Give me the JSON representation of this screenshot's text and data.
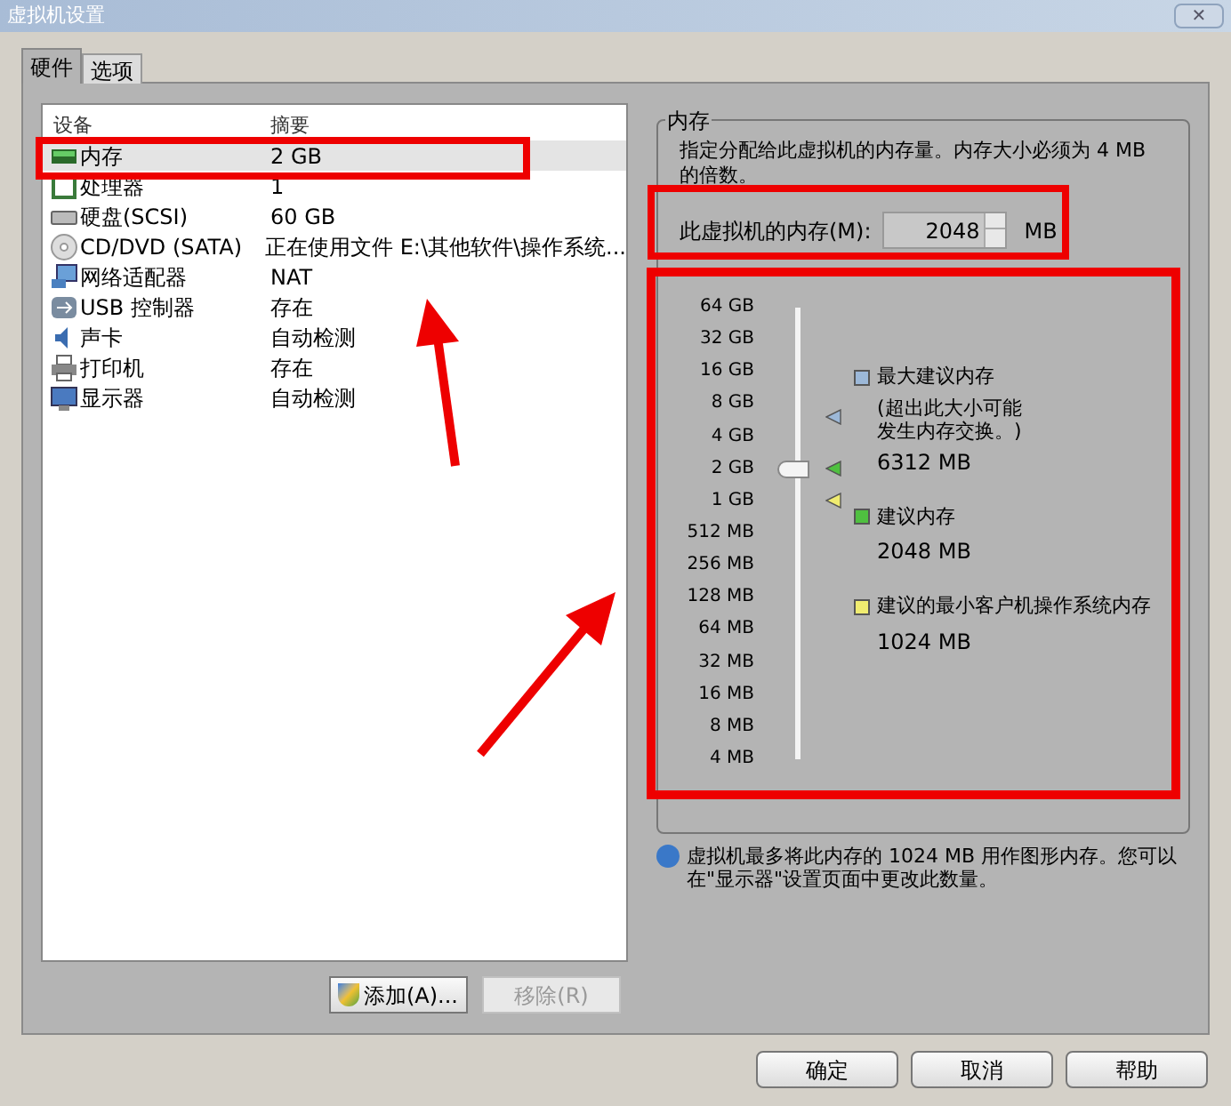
{
  "window": {
    "title": "虚拟机设置",
    "close": "✕"
  },
  "tabs": [
    {
      "label": "硬件",
      "selected": true
    },
    {
      "label": "选项",
      "selected": false
    }
  ],
  "devices": {
    "columns": [
      "设备",
      "摘要"
    ],
    "rows": [
      {
        "name": "内存",
        "summary": "2 GB",
        "selected": true
      },
      {
        "name": "处理器",
        "summary": "1",
        "selected": false
      },
      {
        "name": "硬盘(SCSI)",
        "summary": "60 GB",
        "selected": false
      },
      {
        "name": "CD/DVD (SATA)",
        "summary": "正在使用文件 E:\\其他软件\\操作系统...",
        "selected": false
      },
      {
        "name": "网络适配器",
        "summary": "NAT",
        "selected": false
      },
      {
        "name": "USB 控制器",
        "summary": "存在",
        "selected": false
      },
      {
        "name": "声卡",
        "summary": "自动检测",
        "selected": false
      },
      {
        "name": "打印机",
        "summary": "存在",
        "selected": false
      },
      {
        "name": "显示器",
        "summary": "自动检测",
        "selected": false
      }
    ]
  },
  "list_buttons": [
    {
      "label": "添加(A)...",
      "disabled": false
    },
    {
      "label": "移除(R)",
      "disabled": true
    }
  ],
  "memory": {
    "title": "内存",
    "description": "指定分配给此虚拟机的内存量。内存大小必须为 4 MB 的倍数。",
    "field_label": "此虚拟机的内存(M):",
    "value": "2048",
    "unit": "MB",
    "scale": [
      "64 GB",
      "32 GB",
      "16 GB",
      "8 GB",
      "4 GB",
      "2 GB",
      "1 GB",
      "512 MB",
      "256 MB",
      "128 MB",
      "64 MB",
      "32 MB",
      "16 MB",
      "8 MB",
      "4 MB"
    ],
    "level": 0.643,
    "legend": [
      {
        "title": "最大建议内存",
        "note": "(超出此大小可能发生内存交换。)",
        "value": "6312 MB",
        "color": "#9cb8d8"
      },
      {
        "title": "建议内存",
        "value": "2048 MB",
        "color": "#4fc040"
      },
      {
        "title": "建议的最小客户机操作系统内存",
        "value": "1024 MB",
        "color": "#f0ec70"
      }
    ],
    "slider_markers": [
      {
        "color": "#9cb8d8",
        "level": 0.759
      },
      {
        "color": "#4fc040",
        "level": 0.643
      },
      {
        "color": "#f0ec70",
        "level": 0.571
      }
    ]
  },
  "info": "虚拟机最多将此内存的 1024 MB 用作图形内存。您可以在\"显示器\"设置页面中更改此数量。",
  "dialog_buttons": [
    "确定",
    "取消",
    "帮助"
  ]
}
